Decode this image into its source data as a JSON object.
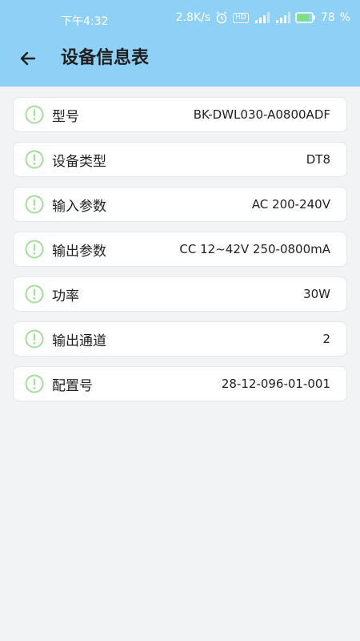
{
  "status_bar": {
    "time": "下午4:32",
    "network_speed": "2.8K/s",
    "hd_label": "HD",
    "battery": "78"
  },
  "header": {
    "title": "设备信息表"
  },
  "info_items": [
    {
      "label": "型号",
      "value": "BK-DWL030-A0800ADF"
    },
    {
      "label": "设备类型",
      "value": "DT8"
    },
    {
      "label": "输入参数",
      "value": "AC 200-240V"
    },
    {
      "label": "输出参数",
      "value": "CC 12~42V 250-0800mA"
    },
    {
      "label": "功率",
      "value": "30W"
    },
    {
      "label": "输出通道",
      "value": "2"
    },
    {
      "label": "配置号",
      "value": "28-12-096-01-001"
    }
  ],
  "colors": {
    "header_bg": "#8fd0f7",
    "page_bg": "#f2f3f5",
    "icon_accent": "#a8dba0"
  },
  "icons": {
    "back": "arrow-left-icon",
    "item": "exclamation-circle-icon"
  }
}
